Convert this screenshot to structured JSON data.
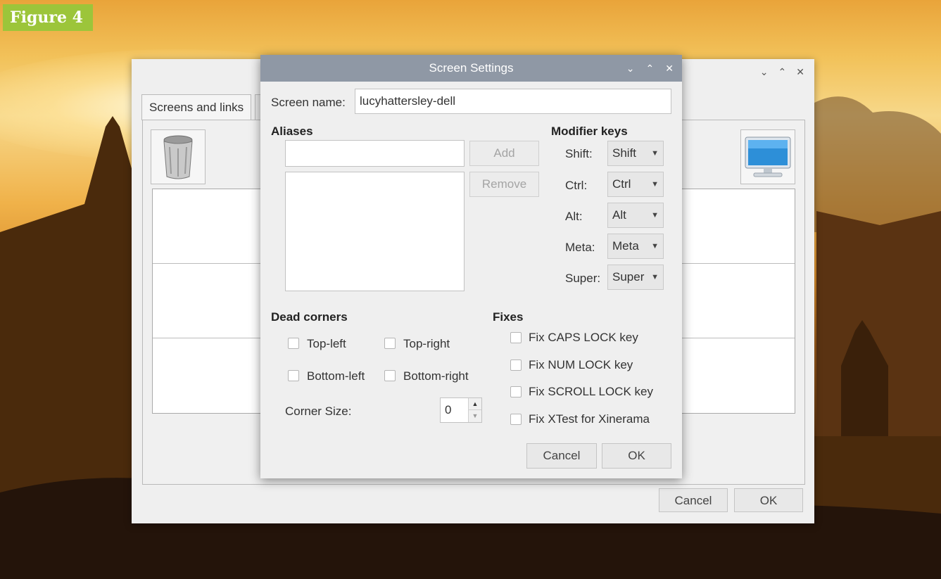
{
  "figure_label": "Figure 4",
  "back_window": {
    "tab_label": "Screens and links",
    "cancel_label": "Cancel",
    "ok_label": "OK",
    "title_controls": [
      "⌄",
      "⌃",
      "✕"
    ]
  },
  "dialog": {
    "title": "Screen Settings",
    "title_controls": [
      "⌄",
      "⌃",
      "✕"
    ],
    "screen_name_label": "Screen name:",
    "screen_name_value": "lucyhattersley-dell",
    "aliases_heading": "Aliases",
    "alias_input_value": "",
    "add_label": "Add",
    "remove_label": "Remove",
    "modifier_heading": "Modifier keys",
    "modifiers": [
      {
        "label": "Shift:",
        "value": "Shift"
      },
      {
        "label": "Ctrl:",
        "value": "Ctrl"
      },
      {
        "label": "Alt:",
        "value": "Alt"
      },
      {
        "label": "Meta:",
        "value": "Meta"
      },
      {
        "label": "Super:",
        "value": "Super"
      }
    ],
    "dead_corners_heading": "Dead corners",
    "corners": [
      "Top-left",
      "Top-right",
      "Bottom-left",
      "Bottom-right"
    ],
    "corner_size_label": "Corner Size:",
    "corner_size_value": "0",
    "fixes_heading": "Fixes",
    "fixes": [
      "Fix CAPS LOCK key",
      "Fix NUM LOCK key",
      "Fix SCROLL LOCK key",
      "Fix XTest for Xinerama"
    ],
    "cancel_label": "Cancel",
    "ok_label": "OK"
  }
}
